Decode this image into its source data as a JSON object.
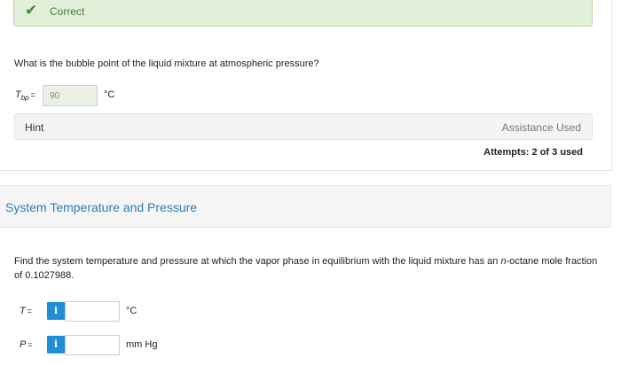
{
  "part1": {
    "status_text": "Correct",
    "question": "What is the bubble point of the liquid mixture at atmospheric pressure?",
    "tbp_symbol": "T",
    "tbp_subscript": "bp",
    "equals": "=",
    "tbp_value": "90",
    "tbp_unit": "°C",
    "hint_label": "Hint",
    "assistance_label": "Assistance Used",
    "attempts": "Attempts: 2 of 3 used"
  },
  "section": {
    "title": "System Temperature and Pressure"
  },
  "part2": {
    "find_text_before": "Find the system temperature and pressure at which the vapor phase in equilibrium with the liquid mixture has an ",
    "find_text_italic": "n",
    "find_text_after": "-octane mole fraction of 0.1027988.",
    "t_symbol": "T",
    "t_equals": "=",
    "t_info": "i",
    "t_unit": "°C",
    "p_symbol": "P",
    "p_equals": "=",
    "p_info": "i",
    "p_unit": "mm Hg"
  },
  "colors": {
    "success_bg": "#e2f0d9",
    "success_check": "#3c8a2e",
    "section_title": "#2a7fb4",
    "info_button": "#1f8ed6"
  },
  "icons": {
    "status": "checkmark-icon",
    "info": "info-icon"
  }
}
